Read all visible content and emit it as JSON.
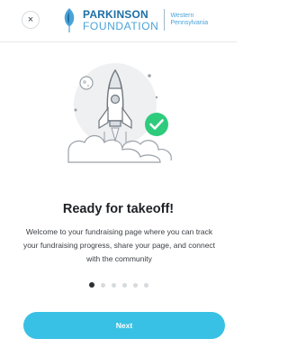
{
  "header": {
    "close_label": "×",
    "logo": {
      "line1": "PARKINSON",
      "line2": "FOUNDATION",
      "region_line1": "Western",
      "region_line2": "Pennsylvania"
    }
  },
  "main": {
    "title": "Ready for takeoff!",
    "description": "Welcome to your fundraising page where you can track your fundraising progress, share your page, and connect with the community"
  },
  "pager": {
    "total": 6,
    "active_index": 0
  },
  "actions": {
    "next_label": "Next"
  },
  "colors": {
    "accent": "#38c1e4",
    "check_badge": "#2fcb7d",
    "logo_dark": "#1d6fa5",
    "logo_light": "#4aa3d8"
  },
  "icons": {
    "close": "close-icon",
    "illustration": "rocket-launch-illustration",
    "badge": "check-badge-icon"
  }
}
